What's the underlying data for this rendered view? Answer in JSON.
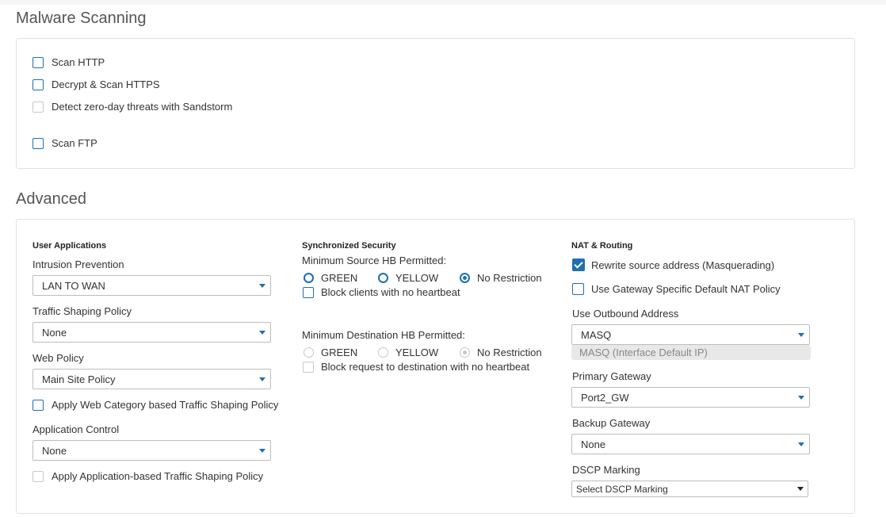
{
  "malware": {
    "title": "Malware Scanning",
    "items": [
      {
        "label": "Scan HTTP",
        "checked": false,
        "enabled": true
      },
      {
        "label": "Decrypt & Scan HTTPS",
        "checked": false,
        "enabled": true
      },
      {
        "label": "Detect zero-day threats with Sandstorm",
        "checked": false,
        "enabled": false
      },
      {
        "label": "Scan FTP",
        "checked": false,
        "enabled": true
      }
    ]
  },
  "advanced": {
    "title": "Advanced",
    "user_apps": {
      "heading": "User Applications",
      "ips_label": "Intrusion Prevention",
      "ips_value": "LAN TO WAN",
      "shaping_label": "Traffic Shaping Policy",
      "shaping_value": "None",
      "web_label": "Web Policy",
      "web_value": "Main Site Policy",
      "web_cat_shaping": "Apply Web Category based Traffic Shaping Policy",
      "app_label": "Application Control",
      "app_value": "None",
      "app_shaping": "Apply Application-based Traffic Shaping Policy"
    },
    "sync_sec": {
      "heading": "Synchronized Security",
      "source_label": "Minimum Source HB Permitted:",
      "source_options": [
        "GREEN",
        "YELLOW",
        "No Restriction"
      ],
      "source_selected": "No Restriction",
      "block_clients": "Block clients with no heartbeat",
      "dest_label": "Minimum Destination HB Permitted:",
      "dest_options": [
        "GREEN",
        "YELLOW",
        "No Restriction"
      ],
      "dest_selected": "No Restriction",
      "block_dest": "Block request to destination with no heartbeat"
    },
    "nat": {
      "heading": "NAT & Routing",
      "masq_label": "Rewrite source address (Masquerading)",
      "masq_checked": true,
      "gw_nat_label": "Use Gateway Specific Default NAT Policy",
      "outbound_label": "Use Outbound Address",
      "outbound_value": "MASQ",
      "outbound_hint": "MASQ (Interface Default IP)",
      "primary_label": "Primary Gateway",
      "primary_value": "Port2_GW",
      "backup_label": "Backup Gateway",
      "backup_value": "None",
      "dscp_label": "DSCP Marking",
      "dscp_value": "Select DSCP Marking"
    }
  },
  "colors": {
    "accent": "#1f6fb2",
    "border": "#e2e2e2",
    "disabled": "#c8c8c8"
  }
}
